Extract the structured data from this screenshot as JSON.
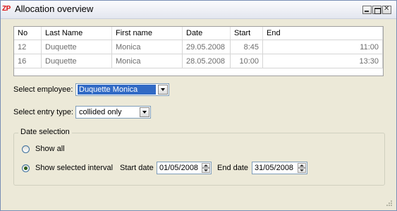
{
  "window": {
    "app_icon_text": "ZP",
    "title": "Allocation overview"
  },
  "grid": {
    "columns": [
      "No",
      "Last Name",
      "First name",
      "Date",
      "Start",
      "End"
    ],
    "rows": [
      {
        "no": "12",
        "last": "Duquette",
        "first": "Monica",
        "date": "29.05.2008",
        "start": "8:45",
        "end": "11:00"
      },
      {
        "no": "16",
        "last": "Duquette",
        "first": "Monica",
        "date": "28.05.2008",
        "start": "10:00",
        "end": "13:30"
      }
    ]
  },
  "employee": {
    "label": "Select employee:",
    "value": "Duquette Monica"
  },
  "entry_type": {
    "label": "Select entry type:",
    "value": "collided only"
  },
  "date_selection": {
    "title": "Date selection",
    "show_all_label": "Show all",
    "show_interval_label": "Show selected interval",
    "selected": "interval",
    "start_label": "Start date",
    "start_value": "01/05/2008",
    "end_label": "End date",
    "end_value": "31/05/2008"
  },
  "colors": {
    "selection": "#316ac5",
    "window_bg": "#ece9d8",
    "desktop": "#a9c4e8"
  }
}
